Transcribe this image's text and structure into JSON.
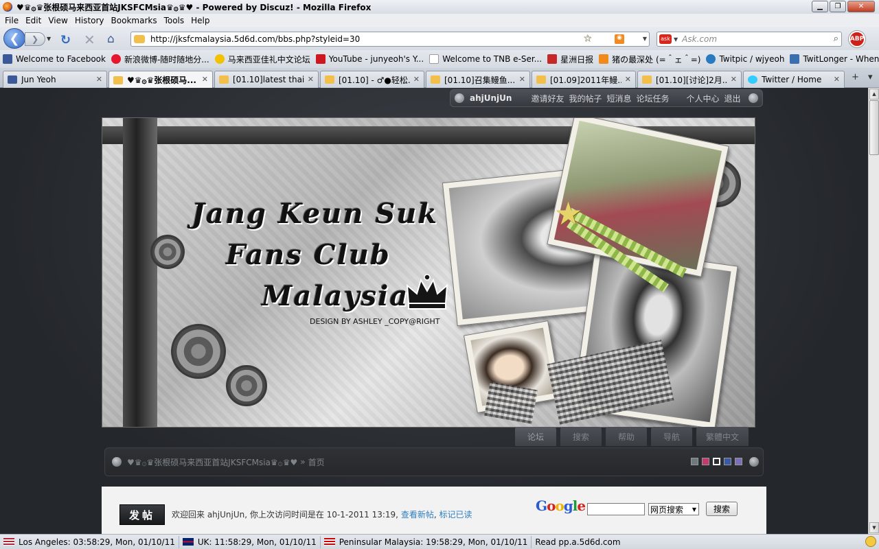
{
  "window": {
    "title": "♥♛۞♛张根硕马来西亚首站JKSFCMsia♛۞♛♥ - Powered by Discuz! - Mozilla Firefox",
    "min": "▁",
    "max": "❐",
    "close": "✕"
  },
  "menu": [
    "File",
    "Edit",
    "View",
    "History",
    "Bookmarks",
    "Tools",
    "Help"
  ],
  "nav": {
    "url": "http://jksfcmalaysia.5d6d.com/bbs.php?styleid=30",
    "search_placeholder": "Ask.com",
    "abp": "ABP"
  },
  "bookmarks": [
    {
      "label": "Welcome to Facebook",
      "color": "#3b5998"
    },
    {
      "label": "新浪微博-随时随地分...",
      "color": "#e6162d"
    },
    {
      "label": "马来西亚佳礼中文论坛",
      "color": "#f2c200"
    },
    {
      "label": "YouTube - junyeoh's Y...",
      "color": "#cc181e"
    },
    {
      "label": "Welcome to TNB e-Ser...",
      "color": "#ffffff"
    },
    {
      "label": "星洲日报",
      "color": "#c62828"
    },
    {
      "label": "猪の最深处 (=＾ェ＾=)",
      "color": "#f08a1c"
    },
    {
      "label": "Twitpic / wjyeoh",
      "color": "#2a7ac0"
    },
    {
      "label": "TwitLonger - When yo...",
      "color": "#3a6fb0"
    }
  ],
  "tabs": [
    {
      "label": "Jun Yeoh",
      "color": "#3b5998",
      "active": false
    },
    {
      "label": "♥♛۞♛张根硕马...",
      "color": "#f2c04a",
      "active": true
    },
    {
      "label": "[01.10]latest thai'...",
      "color": "#f2c04a",
      "active": false
    },
    {
      "label": "[01.10] - ♂●轻松...",
      "color": "#f2c04a",
      "active": false
    },
    {
      "label": "[01.10]召集鳗鱼...",
      "color": "#f2c04a",
      "active": false
    },
    {
      "label": "[01.09]2011年鳗...",
      "color": "#f2c04a",
      "active": false
    },
    {
      "label": "[01.10][讨论]2月...",
      "color": "#f2c04a",
      "active": false
    },
    {
      "label": "Twitter / Home",
      "color": "#33ccff",
      "active": false
    }
  ],
  "tab_controls": {
    "new": "+",
    "list": "▾"
  },
  "userbar": {
    "username": "ahjUnjUn",
    "links": [
      "邀请好友",
      "我的帖子",
      "短消息",
      "论坛任务"
    ],
    "right_links": [
      "个人中心",
      "退出"
    ]
  },
  "banner": {
    "line1": "Jang Keun Suk",
    "line2": "Fans Club",
    "line3": "Malaysia",
    "design": "DESIGN BY ASHLEY _COPY@RIGHT"
  },
  "nav_tabs": [
    "论坛",
    "搜索",
    "帮助",
    "导航",
    "繁體中文"
  ],
  "breadcrumb": {
    "site": "♥♛۞♛张根硕马来西亚首站JKSFCMsia♛۞♛♥",
    "sep": "»",
    "current": "首页"
  },
  "swatches": [
    "#6f7a80",
    "#c23a6e",
    "#ffffff",
    "#3a5aa8",
    "#7a70b8"
  ],
  "main": {
    "post_button": "发帖",
    "welcome_text": "欢迎回来 ahjUnjUn, 你上次访问时间是在 10-1-2011 13:19,",
    "link_new": "查看新帖",
    "sep": ",",
    "link_mark": "标记已读",
    "google_select": "网页搜索",
    "google_button": "搜索"
  },
  "status": [
    {
      "text": "Los Angeles: 03:58:29, Mon, 01/10/11",
      "flag": "us"
    },
    {
      "text": "UK: 11:58:29, Mon, 01/10/11",
      "flag": "uk"
    },
    {
      "text": "Peninsular Malaysia: 19:58:29, Mon, 01/10/11",
      "flag": "my"
    },
    {
      "text": "Read pp.a.5d6d.com",
      "flag": ""
    }
  ]
}
